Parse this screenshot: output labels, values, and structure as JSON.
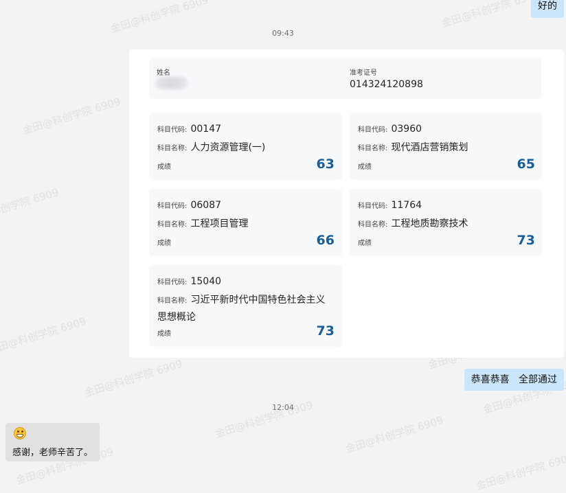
{
  "watermark_text": "金田@科创学院 6909",
  "messages": {
    "top_outgoing": "好的",
    "time1": "09:43",
    "congrats": "恭喜恭喜   全部通过",
    "time2": "12:04",
    "incoming_text": "感谢，老师辛苦了。"
  },
  "result_card": {
    "name_label": "姓名",
    "ticket_label": "准考证号",
    "ticket_number": "014324120898",
    "subjects": [
      {
        "code_label": "科目代码:",
        "code": "00147",
        "name_label": "科目名称:",
        "name": "人力资源管理(一)",
        "score_label": "成绩",
        "score": "63"
      },
      {
        "code_label": "科目代码:",
        "code": "03960",
        "name_label": "科目名称:",
        "name": "现代酒店营销策划",
        "score_label": "成绩",
        "score": "65"
      },
      {
        "code_label": "科目代码:",
        "code": "06087",
        "name_label": "科目名称:",
        "name": "工程项目管理",
        "score_label": "成绩",
        "score": "66"
      },
      {
        "code_label": "科目代码:",
        "code": "11764",
        "name_label": "科目名称:",
        "name": "工程地质勘察技术",
        "score_label": "成绩",
        "score": "73"
      },
      {
        "code_label": "科目代码:",
        "code": "15040",
        "name_label": "科目名称:",
        "name": "习近平新时代中国特色社会主义思想概论",
        "score_label": "成绩",
        "score": "73"
      }
    ]
  },
  "icons": {
    "incoming_emoji": "grinning-face-icon"
  },
  "colors": {
    "outgoing_bubble": "#cbe6fb",
    "score": "#1a5e99",
    "incoming_bubble": "#e1e1e2"
  }
}
